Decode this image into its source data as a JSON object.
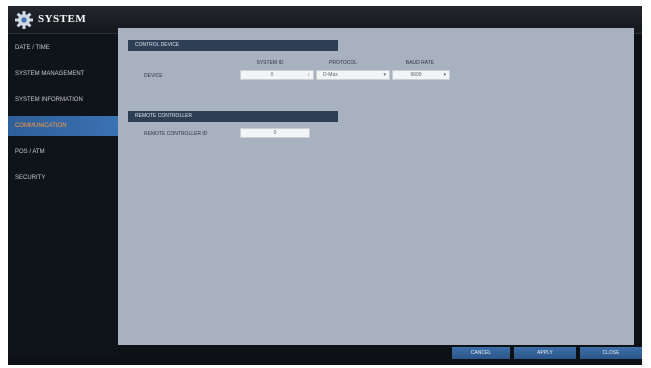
{
  "app": {
    "title": "SYSTEM",
    "icon": "gear-icon"
  },
  "sidebar": {
    "items": [
      {
        "label": "DATE / TIME",
        "active": false
      },
      {
        "label": "SYSTEM MANAGEMENT",
        "active": false
      },
      {
        "label": "SYSTEM INFORMATION",
        "active": false
      },
      {
        "label": "COMMUNICATION",
        "active": true
      },
      {
        "label": "POS / ATM",
        "active": false
      },
      {
        "label": "SECURITY",
        "active": false
      }
    ]
  },
  "control_device": {
    "header": "CONTROL DEVICE",
    "columns": {
      "system_id": "SYSTEM ID",
      "protocol": "PROTOCOL",
      "baud_rate": "BAUD RATE"
    },
    "row_label": "DEVICE",
    "system_id_value": "0",
    "protocol_value": "D-Max",
    "baud_rate_value": "9600"
  },
  "remote_controller": {
    "header": "REMOTE CONTROLLER",
    "id_label": "REMOTE CONTROLLER ID",
    "id_value": "0"
  },
  "buttons": {
    "cancel": "CANCEL",
    "apply": "APPLY",
    "close": "CLOSE"
  },
  "colors": {
    "accent": "#3a73b5",
    "active_text": "#ff9a3a",
    "panel": "#a7b1c0"
  }
}
